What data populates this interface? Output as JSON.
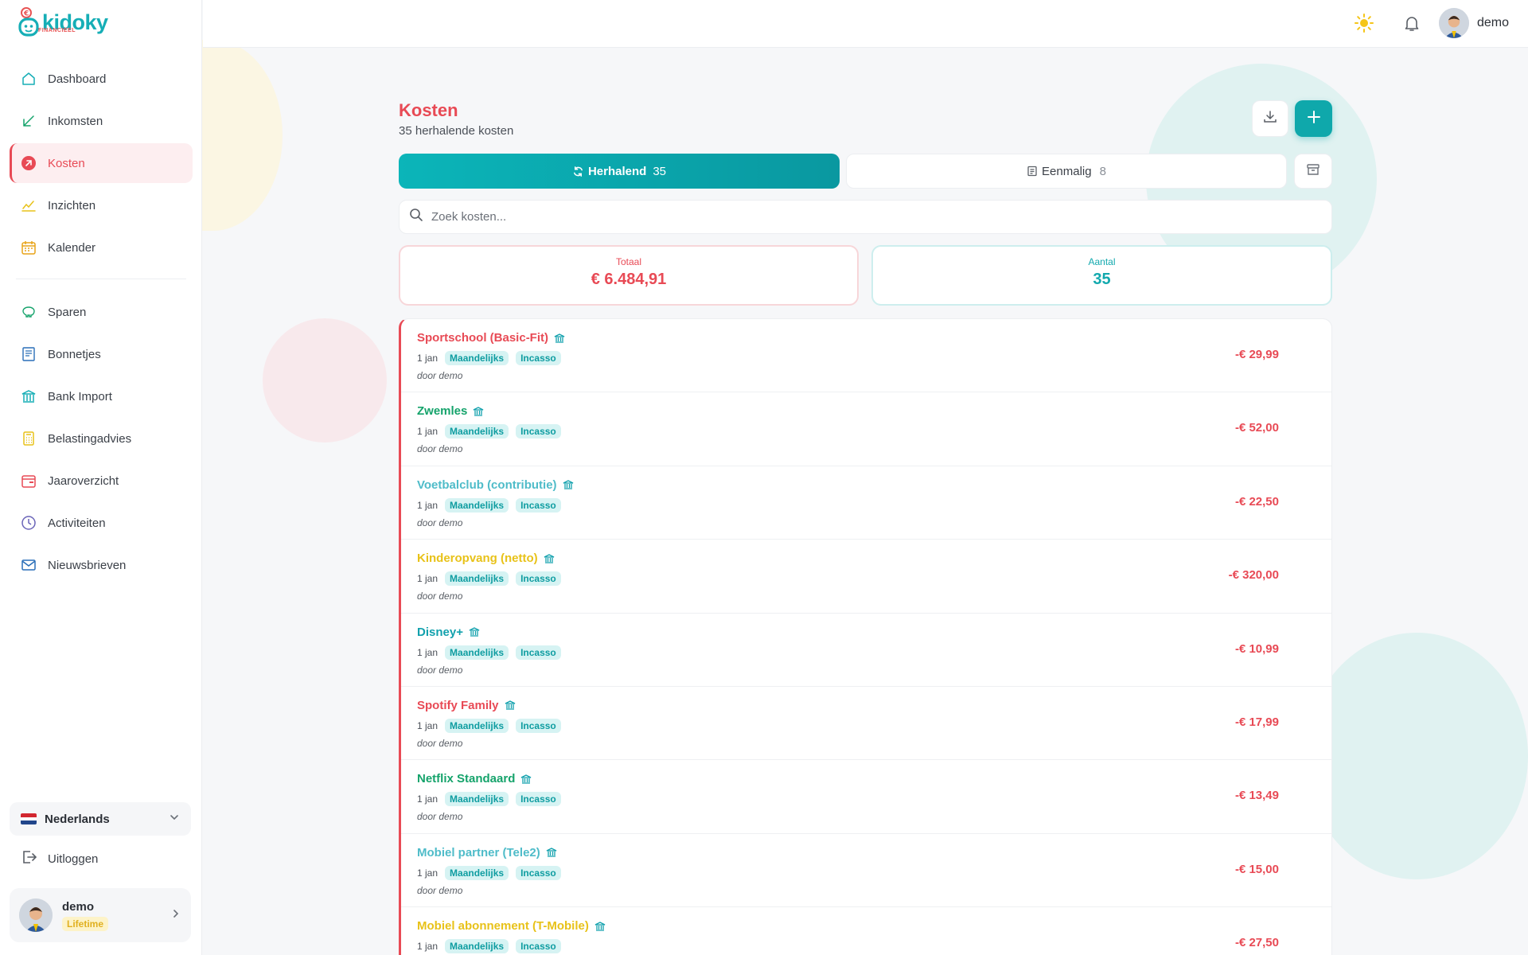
{
  "brand": {
    "name": "kidoky",
    "sub": "FINANCIEEL"
  },
  "sidebar": {
    "items": [
      {
        "label": "Dashboard",
        "icon": "home-icon"
      },
      {
        "label": "Inkomsten",
        "icon": "arrow-down-left-icon"
      },
      {
        "label": "Kosten",
        "icon": "arrow-up-right-icon",
        "active": true
      },
      {
        "label": "Inzichten",
        "icon": "chart-line-icon"
      },
      {
        "label": "Kalender",
        "icon": "calendar-icon"
      },
      {
        "label": "Sparen",
        "icon": "piggy-bank-icon"
      },
      {
        "label": "Bonnetjes",
        "icon": "receipt-icon"
      },
      {
        "label": "Bank Import",
        "icon": "bank-icon"
      },
      {
        "label": "Belastingadvies",
        "icon": "calculator-icon"
      },
      {
        "label": "Jaaroverzicht",
        "icon": "calendar-range-icon"
      },
      {
        "label": "Activiteiten",
        "icon": "clock-icon"
      },
      {
        "label": "Nieuwsbrieven",
        "icon": "mail-icon"
      }
    ],
    "language": "Nederlands",
    "logout": "Uitloggen",
    "user": {
      "name": "demo",
      "plan": "Lifetime"
    }
  },
  "topbar": {
    "username": "demo"
  },
  "page": {
    "title": "Kosten",
    "subtitle": "35 herhalende kosten",
    "tabs": {
      "recurring": {
        "label": "Herhalend",
        "count": "35"
      },
      "once": {
        "label": "Eenmalig",
        "count": "8"
      }
    },
    "search_placeholder": "Zoek kosten...",
    "stats": {
      "total_label": "Totaal",
      "total_value": "€ 6.484,91",
      "count_label": "Aantal",
      "count_value": "35"
    }
  },
  "colors": {
    "accent": "#0fa8ab",
    "danger": "#e84a55",
    "green": "#15a36b",
    "teal_light": "#4fbcc9",
    "yellow": "#e8c219"
  },
  "expenses": [
    {
      "name": "Sportschool (Basic-Fit)",
      "color": "#e84a55",
      "date": "1 jan",
      "freq": "Maandelijks",
      "method": "Incasso",
      "by": "door demo",
      "amount": "-€ 29,99"
    },
    {
      "name": "Zwemles",
      "color": "#15a36b",
      "date": "1 jan",
      "freq": "Maandelijks",
      "method": "Incasso",
      "by": "door demo",
      "amount": "-€ 52,00"
    },
    {
      "name": "Voetbalclub (contributie)",
      "color": "#4fbcc9",
      "date": "1 jan",
      "freq": "Maandelijks",
      "method": "Incasso",
      "by": "door demo",
      "amount": "-€ 22,50"
    },
    {
      "name": "Kinderopvang (netto)",
      "color": "#e8c219",
      "date": "1 jan",
      "freq": "Maandelijks",
      "method": "Incasso",
      "by": "door demo",
      "amount": "-€ 320,00"
    },
    {
      "name": "Disney+",
      "color": "#12a1ad",
      "date": "1 jan",
      "freq": "Maandelijks",
      "method": "Incasso",
      "by": "door demo",
      "amount": "-€ 10,99"
    },
    {
      "name": "Spotify Family",
      "color": "#e84a55",
      "date": "1 jan",
      "freq": "Maandelijks",
      "method": "Incasso",
      "by": "door demo",
      "amount": "-€ 17,99"
    },
    {
      "name": "Netflix Standaard",
      "color": "#15a36b",
      "date": "1 jan",
      "freq": "Maandelijks",
      "method": "Incasso",
      "by": "door demo",
      "amount": "-€ 13,49"
    },
    {
      "name": "Mobiel partner (Tele2)",
      "color": "#4fbcc9",
      "date": "1 jan",
      "freq": "Maandelijks",
      "method": "Incasso",
      "by": "door demo",
      "amount": "-€ 15,00"
    },
    {
      "name": "Mobiel abonnement (T-Mobile)",
      "color": "#e8c219",
      "date": "1 jan",
      "freq": "Maandelijks",
      "method": "Incasso",
      "by": "",
      "amount": "-€ 27,50"
    }
  ]
}
